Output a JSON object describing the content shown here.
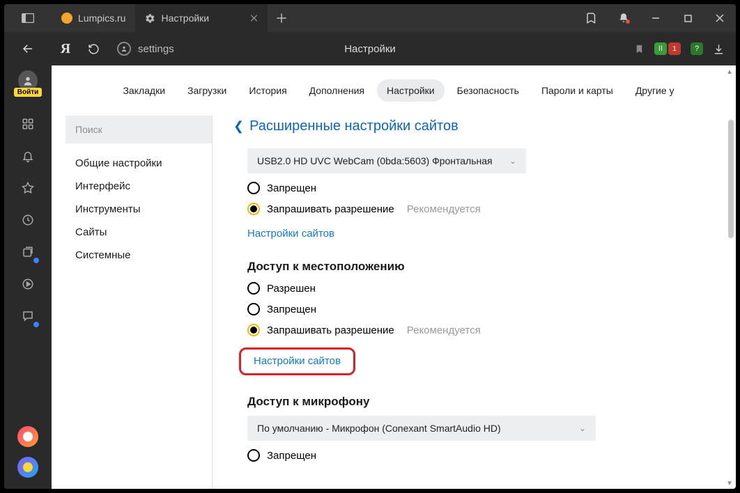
{
  "titlebar": {
    "tab1": {
      "label": "Lumpics.ru"
    },
    "tab2": {
      "label": "Настройки"
    }
  },
  "addressbar": {
    "url": "settings",
    "page_title": "Настройки"
  },
  "rail": {
    "login": "Войти"
  },
  "topnav": {
    "bookmarks": "Закладки",
    "downloads": "Загрузки",
    "history": "История",
    "addons": "Дополнения",
    "settings": "Настройки",
    "security": "Безопасность",
    "passwords": "Пароли и карты",
    "other": "Другие у"
  },
  "sidepanel": {
    "search_placeholder": "Поиск",
    "items": {
      "general": "Общие настройки",
      "interface": "Интерфейс",
      "tools": "Инструменты",
      "sites": "Сайты",
      "system": "Системные"
    }
  },
  "main": {
    "section_title": "Расширенные настройки сайтов",
    "camera_dropdown": "USB2.0 HD UVC WebCam (0bda:5603) Фронтальная",
    "radio_denied": "Запрещен",
    "radio_ask": "Запрашивать разрешение",
    "recommended": "Рекомендуется",
    "sites_link": "Настройки сайтов",
    "location_head": "Доступ к местоположению",
    "radio_allowed": "Разрешен",
    "sites_link2": "Настройки сайтов",
    "mic_head": "Доступ к микрофону",
    "mic_dropdown": "По умолчанию - Микрофон (Conexant SmartAudio HD)"
  }
}
